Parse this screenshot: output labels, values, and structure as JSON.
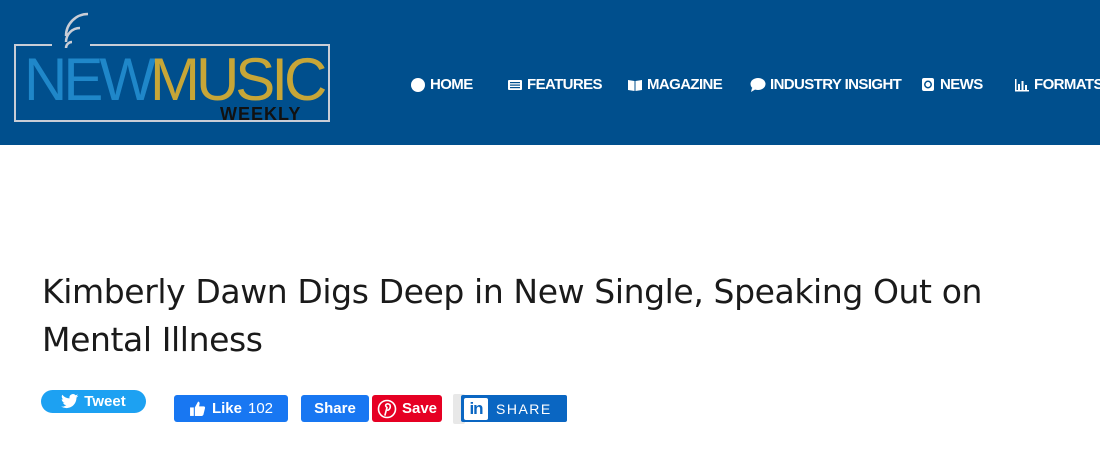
{
  "logo": {
    "word1": "NEW",
    "word2": "MUSIC",
    "word3": "WEEKLY"
  },
  "nav": {
    "items": [
      {
        "label": "HOME",
        "icon": "circle-icon"
      },
      {
        "label": "FEATURES",
        "icon": "newspaper-icon"
      },
      {
        "label": "MAGAZINE",
        "icon": "book-icon"
      },
      {
        "label": "INDUSTRY INSIGHT",
        "icon": "chat-bubble-icon"
      },
      {
        "label": "NEWS",
        "icon": "notebook-icon"
      },
      {
        "label": "FORMATS",
        "icon": "bar-chart-icon"
      }
    ]
  },
  "article": {
    "title": "Kimberly Dawn Digs Deep in New Single, Speaking Out on Mental Illness"
  },
  "social": {
    "tweet_label": "Tweet",
    "like_label": "Like",
    "like_count": "102",
    "share_label": "Share",
    "save_label": "Save",
    "linkedin_label": "SHARE",
    "colors": {
      "twitter": "#1da1f2",
      "facebook": "#1877f2",
      "pinterest": "#e60023",
      "linkedin": "#0a66c2"
    }
  },
  "colors": {
    "header_bg": "#004f8d",
    "logo_new": "#1f87c9",
    "logo_music": "#c7a637"
  }
}
